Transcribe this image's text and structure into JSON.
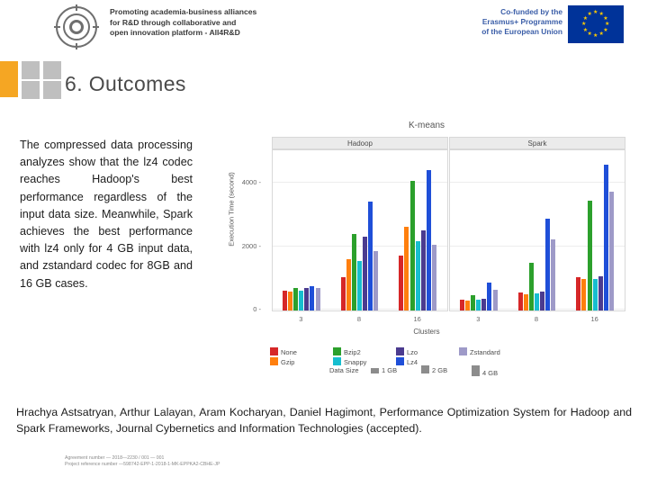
{
  "header": {
    "tagline_line1": "Promoting academia-business alliances",
    "tagline_line2": "for R&D through collaborative and",
    "tagline_line3": "open innovation platform - All4R&D",
    "eu_line1": "Co-funded by the",
    "eu_line2": "Erasmus+ Programme",
    "eu_line3": "of the European Union"
  },
  "slide": {
    "title": "6. Outcomes",
    "body": "The compressed data processing analyzes show that the lz4 codec reaches Hadoop's best performance regardless of the input data size. Meanwhile, Spark achieves the best performance with lz4 only for 4 GB input data, and zstandard codec for 8GB and 16 GB cases.",
    "citation": "Hrachya Astsatryan, Arthur Lalayan, Aram Kocharyan, Daniel Hagimont, Performance Optimization System for Hadoop and Spark Frameworks, Journal Cybernetics and Information Technologies (accepted).",
    "footer_line1": "Agreement number — 2018—2230 / 001 — 001",
    "footer_line2": "Project reference number —598742-EPP-1-2018-1-MK-EPPKA2-CBHE-JP"
  },
  "chart_data": {
    "type": "bar",
    "title": "K-means",
    "xlabel": "Clusters",
    "ylabel": "Execution Time (second)",
    "facets": [
      "Hadoop",
      "Spark"
    ],
    "categories": [
      "3",
      "8",
      "16"
    ],
    "ylim": [
      0,
      5000
    ],
    "yticks": [
      0,
      2000,
      4000
    ],
    "ytick_labels": [
      "0 -",
      "2000 -",
      "4000 -"
    ],
    "grid": true,
    "legend_position": "bottom",
    "legend_codecs": [
      {
        "label": "None",
        "color": "#d62728"
      },
      {
        "label": "Bzip2",
        "color": "#2ca02c"
      },
      {
        "label": "Lzo",
        "color": "#4b3b8f"
      },
      {
        "label": "Zstandard",
        "color": "#9e9ac8"
      },
      {
        "label": "Gzip",
        "color": "#ff7f0e"
      },
      {
        "label": "Snappy",
        "color": "#17becf"
      },
      {
        "label": "Lz4",
        "color": "#1f4fd8"
      }
    ],
    "legend2_title": "Data Size",
    "legend2_items": [
      {
        "label": "1 GB",
        "color": "#8c8c8c"
      },
      {
        "label": "2 GB",
        "color": "#8c8c8c"
      },
      {
        "label": "4 GB",
        "color": "#8c8c8c"
      }
    ],
    "series": [
      {
        "name": "None",
        "color": "#d62728",
        "hadoop": [
          620,
          1030,
          1720
        ],
        "spark": [
          330,
          560,
          1050
        ]
      },
      {
        "name": "Gzip",
        "color": "#ff7f0e",
        "hadoop": [
          600,
          1600,
          2600
        ],
        "spark": [
          320,
          520,
          980
        ]
      },
      {
        "name": "Bzip2",
        "color": "#2ca02c",
        "hadoop": [
          700,
          2380,
          4050
        ],
        "spark": [
          470,
          1500,
          3430
        ]
      },
      {
        "name": "Snappy",
        "color": "#17becf",
        "hadoop": [
          610,
          1550,
          2150
        ],
        "spark": [
          330,
          540,
          990
        ]
      },
      {
        "name": "Lzo",
        "color": "#4b3b8f",
        "hadoop": [
          690,
          2300,
          2500
        ],
        "spark": [
          360,
          600,
          1080
        ]
      },
      {
        "name": "Lz4",
        "color": "#1f4fd8",
        "hadoop": [
          760,
          3400,
          4380
        ],
        "spark": [
          880,
          2860,
          4560
        ]
      },
      {
        "name": "Zstandard",
        "color": "#9e9ac8",
        "hadoop": [
          700,
          1850,
          2050
        ],
        "spark": [
          640,
          2230,
          3700
        ]
      }
    ]
  }
}
